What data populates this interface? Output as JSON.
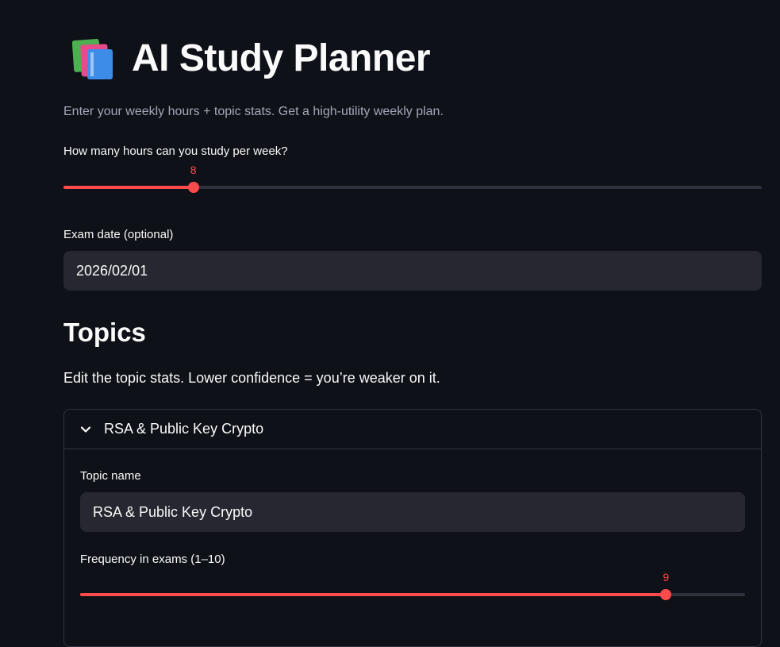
{
  "app": {
    "title": "AI Study Planner",
    "title_icon": "books-emoji",
    "subtitle": "Enter your weekly hours + topic stats. Get a high-utility weekly plan."
  },
  "hours_slider": {
    "label": "How many hours can you study per week?",
    "value": "8",
    "fraction": 0.186
  },
  "exam_date": {
    "label": "Exam date (optional)",
    "value": "2026/02/01"
  },
  "topics": {
    "heading": "Topics",
    "description": "Edit the topic stats. Lower confidence = you’re weaker on it.",
    "expander": {
      "title": "RSA & Public Key Crypto",
      "expanded": true,
      "topic_name_label": "Topic name",
      "topic_name_value": "RSA & Public Key Crypto",
      "frequency_label": "Frequency in exams (1–10)",
      "frequency_value": "9",
      "frequency_fraction": 0.881
    }
  },
  "colors": {
    "background": "#0e1117",
    "accent": "#ff4b4b",
    "input_bg": "#262730",
    "muted_text": "#a3a8b8"
  }
}
